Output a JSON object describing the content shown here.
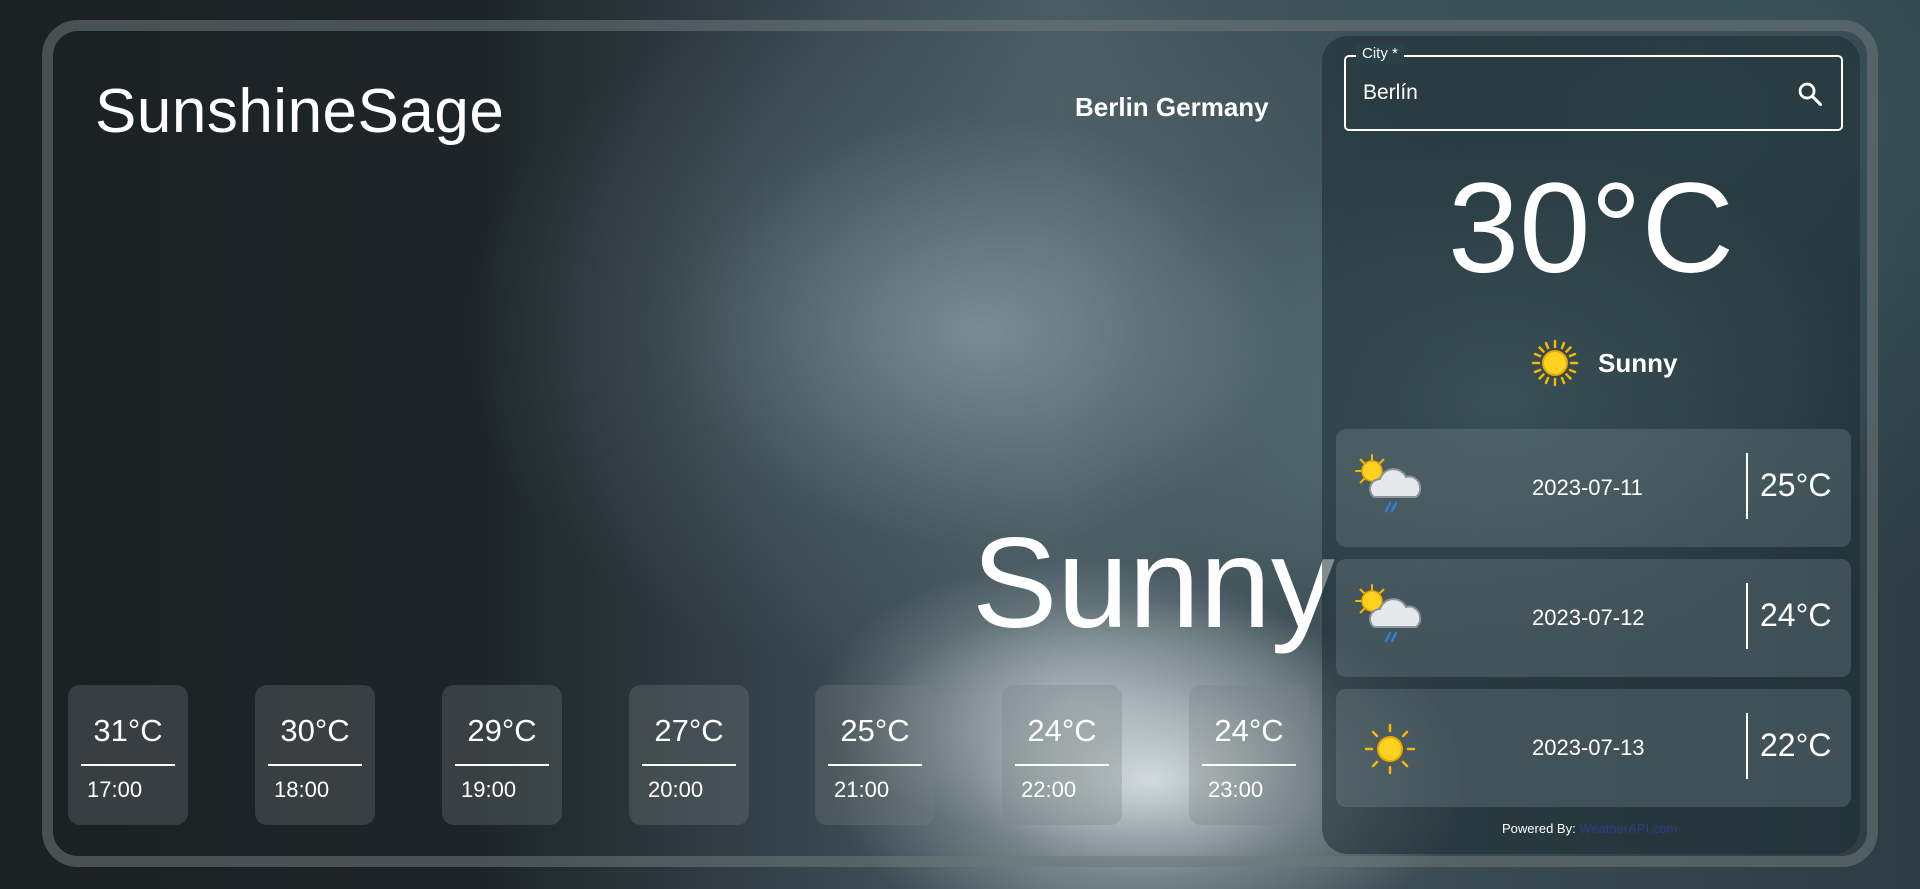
{
  "app": {
    "title": "SunshineSage"
  },
  "location": "Berlin Germany",
  "big_condition": "Sunny",
  "search": {
    "label": "City *",
    "value": "Berlín"
  },
  "current": {
    "temperature": "30°C",
    "condition": "Sunny",
    "icon": "sun-icon"
  },
  "daily": [
    {
      "date": "2023-07-11",
      "temp": "25°C",
      "icon": "sun-cloud-rain-icon"
    },
    {
      "date": "2023-07-12",
      "temp": "24°C",
      "icon": "sun-cloud-rain-icon"
    },
    {
      "date": "2023-07-13",
      "temp": "22°C",
      "icon": "sun-icon"
    }
  ],
  "hourly": [
    {
      "temp": "31°C",
      "time": "17:00"
    },
    {
      "temp": "30°C",
      "time": "18:00"
    },
    {
      "temp": "29°C",
      "time": "19:00"
    },
    {
      "temp": "27°C",
      "time": "20:00"
    },
    {
      "temp": "25°C",
      "time": "21:00"
    },
    {
      "temp": "24°C",
      "time": "22:00"
    },
    {
      "temp": "24°C",
      "time": "23:00"
    }
  ],
  "footer": {
    "powered_label": "Powered By:",
    "powered_link": "WeatherAPI.com"
  },
  "colors": {
    "text": "#ffffff",
    "sun": "#f5b800",
    "link": "#2f3a8a"
  }
}
